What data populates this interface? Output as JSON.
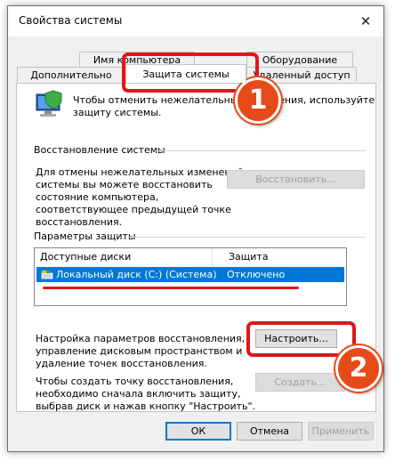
{
  "window": {
    "title": "Свойства системы",
    "close_glyph": "✕"
  },
  "tabs": {
    "top_row": [
      {
        "label": "Имя компьютера"
      },
      {
        "label": "Оборудование"
      }
    ],
    "bottom_row": [
      {
        "label": "Дополнительно"
      },
      {
        "label": "Защита системы"
      },
      {
        "label": "Удаленный доступ"
      }
    ]
  },
  "intro": {
    "line1": "Чтобы отменить нежелательные изменения, используйте",
    "line2": "защиту системы."
  },
  "restore": {
    "heading": "Восстановление системы",
    "text": [
      "Для отмены нежелательных изменений",
      "системы вы можете восстановить",
      "состояние компьютера,",
      "соответствующее предыдущей точке",
      "восстановления."
    ],
    "button": "Восстановить..."
  },
  "protection": {
    "heading": "Параметры защиты",
    "columns": [
      "Доступные диски",
      "Защита"
    ],
    "rows": [
      {
        "drive": "Локальный диск (C:) (Система)",
        "status": "Отключено"
      }
    ],
    "configure_text": [
      "Настройка параметров восстановления,",
      "управление дисковым пространством и",
      "удаление точек восстановления."
    ],
    "configure_button": "Настроить...",
    "create_text": [
      "Чтобы создать точку восстановления,",
      "необходимо сначала включить защиту,",
      "выбрав диск и нажав кнопку \"Настроить\"."
    ],
    "create_button": "Создать..."
  },
  "footer": {
    "ok": "ОК",
    "cancel": "Отмена",
    "apply": "Применить"
  },
  "annotations": {
    "badge1": "1",
    "badge2": "2",
    "accent_color": "#e0161b"
  }
}
